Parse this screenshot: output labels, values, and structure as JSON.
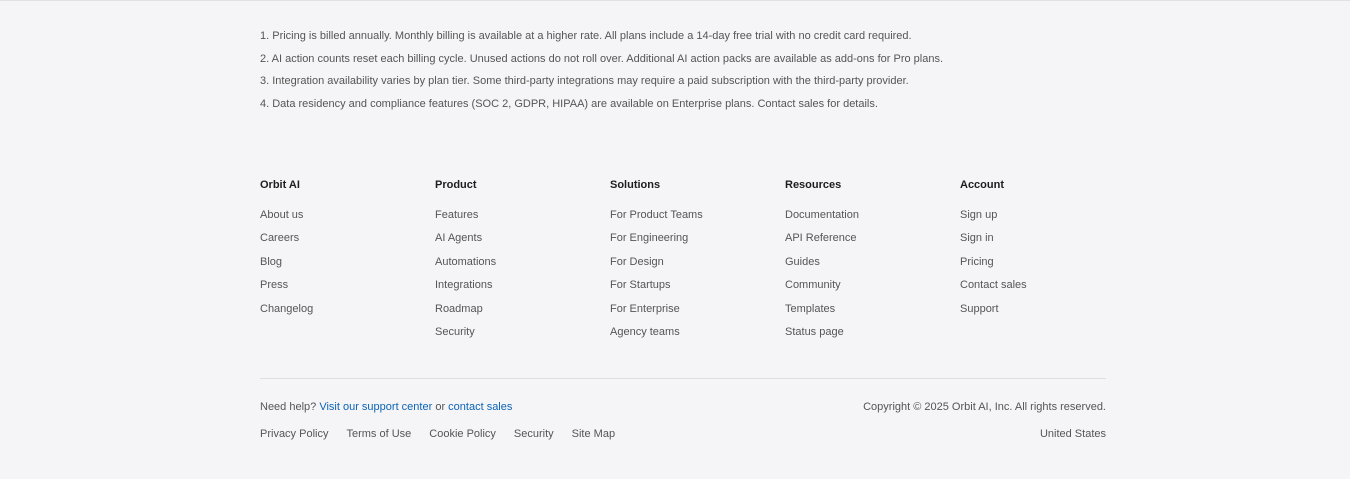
{
  "footnotes": [
    "1. Pricing is billed annually. Monthly billing is available at a higher rate. All plans include a 14-day free trial with no credit card required.",
    "2. AI action counts reset each billing cycle. Unused actions do not roll over. Additional AI action packs are available as add-ons for Pro plans.",
    "3. Integration availability varies by plan tier. Some third-party integrations may require a paid subscription with the third-party provider.",
    "4. Data residency and compliance features (SOC 2, GDPR, HIPAA) are available on Enterprise plans. Contact sales for details."
  ],
  "columns": [
    {
      "title": "Orbit AI",
      "links": [
        "About us",
        "Careers",
        "Blog",
        "Press",
        "Changelog"
      ]
    },
    {
      "title": "Product",
      "links": [
        "Features",
        "AI Agents",
        "Automations",
        "Integrations",
        "Roadmap",
        "Security"
      ]
    },
    {
      "title": "Solutions",
      "links": [
        "For Product Teams",
        "For Engineering",
        "For Design",
        "For Startups",
        "For Enterprise",
        "Agency teams"
      ]
    },
    {
      "title": "Resources",
      "links": [
        "Documentation",
        "API Reference",
        "Guides",
        "Community",
        "Templates",
        "Status page"
      ]
    },
    {
      "title": "Account",
      "links": [
        "Sign up",
        "Sign in",
        "Pricing",
        "Contact sales",
        "Support"
      ]
    }
  ],
  "help": {
    "prefix": "Need help?",
    "support_link": "Visit our support center",
    "or": "or",
    "sales_link": "contact sales"
  },
  "copyright": "Copyright © 2025 Orbit AI, Inc. All rights reserved.",
  "legal_links": [
    "Privacy Policy",
    "Terms of Use",
    "Cookie Policy",
    "Security",
    "Site Map"
  ],
  "region": "United States",
  "colors": {
    "background": "#f5f5f7",
    "link_blue": "#0b63b6",
    "heading": "#1d1d1f",
    "text": "#555555"
  }
}
